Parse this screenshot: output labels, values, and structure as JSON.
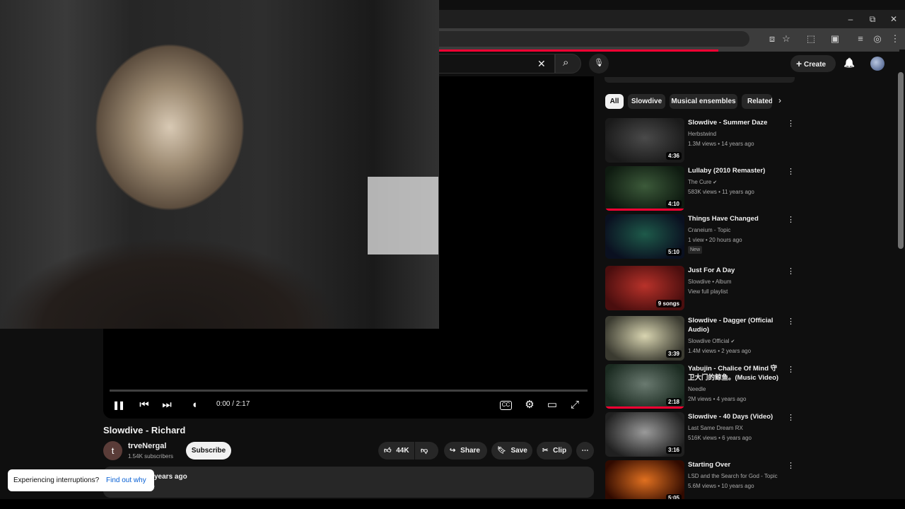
{
  "browser": {
    "window_controls": [
      "–",
      "⧉",
      "✕"
    ],
    "address_icons": [
      "cast-icon",
      "star-icon",
      "extensions-icon",
      "media-icon",
      "reading-list-icon",
      "profile-icon",
      "menu-icon"
    ]
  },
  "masthead": {
    "create_label": "Create",
    "clear_icon": "✕",
    "search_icon": "⌕",
    "mic_icon": "🎙",
    "bell_icon": "🔔"
  },
  "player": {
    "time": "0:00 / 2:17",
    "progress": 0,
    "controls": {
      "play_pause": "❚❚",
      "prev": "⏮",
      "next": "⏭",
      "volume": "◖",
      "captions": "CC",
      "settings": "⚙",
      "theater": "▭",
      "fullscreen": "⤢"
    }
  },
  "video": {
    "title": "Slowdive - Richard",
    "channel": {
      "avatar_letter": "t",
      "name": "trveNergal",
      "subscribers": "1.54K subscribers",
      "subscribe_label": "Subscribe"
    },
    "actions": {
      "likes": "44K",
      "share": "Share",
      "save": "Save",
      "clip": "Clip",
      "more": "⋯"
    },
    "description": {
      "date_fragment": "years ago",
      "second_line": "e"
    }
  },
  "toast": {
    "message": "Experiencing interruptions?",
    "link": "Find out why"
  },
  "chips": [
    "All",
    "Slowdive",
    "Musical ensembles",
    "Related"
  ],
  "recommendations": [
    {
      "title": "Slowdive - Summer Daze",
      "channel": "Herbstwind",
      "meta": "1.3M views • 14 years ago",
      "duration": "4:36",
      "badge": "",
      "verified": false,
      "colors": [
        "#4a4a4a",
        "#1a1a1a"
      ]
    },
    {
      "title": "Lullaby (2010 Remaster)",
      "channel": "The Cure",
      "meta": "583K views • 11 years ago",
      "duration": "4:10",
      "badge": "",
      "verified": true,
      "colors": [
        "#3c5a3a",
        "#0e1a10"
      ]
    },
    {
      "title": "Things Have Changed",
      "channel": "Craneium - Topic",
      "meta": "1 view • 20 hours ago",
      "duration": "5:10",
      "badge": "New",
      "verified": false,
      "colors": [
        "#1e5a4a",
        "#0a1020"
      ]
    },
    {
      "title": "Just For A Day",
      "channel": "Slowdive • Album",
      "meta": "View full playlist",
      "duration": "9 songs",
      "badge": "",
      "verified": false,
      "colors": [
        "#b8322a",
        "#4a0e0e"
      ]
    },
    {
      "title": "Slowdive - Dagger (Official Audio)",
      "channel": "Slowdive Official",
      "meta": "1.4M views • 2 years ago",
      "duration": "3:39",
      "badge": "",
      "verified": true,
      "colors": [
        "#d8d4b0",
        "#3a3a30"
      ]
    },
    {
      "title": "Yabujin - Chalice Of Mind 守卫大门的鲸鱼。(Music Video)",
      "channel": "Needle",
      "meta": "2M views • 4 years ago",
      "duration": "2:18",
      "badge": "",
      "verified": false,
      "colors": [
        "#6a7a70",
        "#1a2a20"
      ]
    },
    {
      "title": "Slowdive - 40 Days (Video)",
      "channel": "Last Same Dream RX",
      "meta": "516K views • 6 years ago",
      "duration": "3:16",
      "badge": "",
      "verified": false,
      "colors": [
        "#9a9a9a",
        "#202020"
      ]
    },
    {
      "title": "Starting Over",
      "channel": "LSD and the Search for God - Topic",
      "meta": "5.6M views • 10 years ago",
      "duration": "5:05",
      "badge": "",
      "verified": false,
      "colors": [
        "#e07020",
        "#300a00"
      ]
    }
  ],
  "colors": {
    "accent": "#ff0033",
    "link": "#065fd4",
    "chip_active_bg": "#f1f1f1"
  }
}
